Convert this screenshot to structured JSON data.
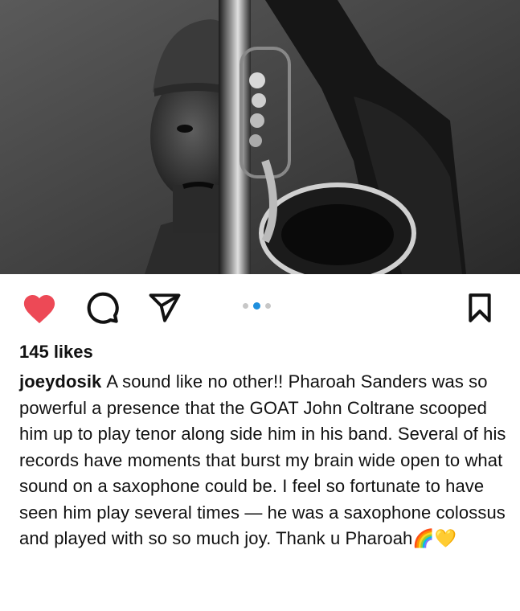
{
  "post": {
    "image_alt": "Black and white photo of a saxophonist in a knit cap holding a saxophone up",
    "likes": "145 likes",
    "username": "joeydosik",
    "caption": "A sound like no other!! Pharoah Sanders was so powerful a presence that the GOAT John Coltrane scooped him up to play tenor along side him in his band. Several of his records have moments that burst my brain wide open to what sound on a saxophone could be. I feel so fortunate to have seen him play several times — he was a saxophone colossus and played with so so much joy. Thank u Pharoah",
    "caption_emoji": "🌈💛"
  },
  "carousel": {
    "count": 3,
    "active": 2
  },
  "icons": {
    "like": "heart-icon",
    "comment": "comment-icon",
    "share": "send-icon",
    "save": "bookmark-icon"
  },
  "colors": {
    "like_red": "#ed4956",
    "carousel_active": "#1f8fdd",
    "carousel_inactive": "#c7c7c7"
  }
}
